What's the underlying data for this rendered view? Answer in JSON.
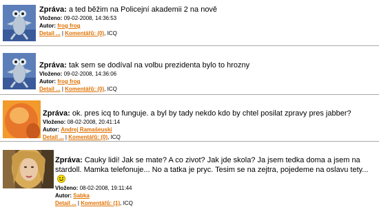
{
  "labels": {
    "message": "Zpráva:",
    "posted": "Vloženo:",
    "author": "Autor:",
    "detail": "Detail ...",
    "comments_prefix": "Komentářů:",
    "icq": "ICQ"
  },
  "posts": [
    {
      "avatar": "crazy-frog-avatar",
      "text": "a ted běžim na Policejní akademii 2 na nově",
      "date": "09-02-2008, 14:36:53",
      "author": "frog frog",
      "comments": "(0)"
    },
    {
      "avatar": "crazy-frog-avatar",
      "text": "tak sem se dodíval na volbu prezidenta bylo to hrozny",
      "date": "09-02-2008, 14:36:06",
      "author": "frog frog",
      "comments": "(0)"
    },
    {
      "avatar": "bald-head-avatar",
      "text": "ok. pres icq to funguje. a byl by tady nekdo kdo by chtel posilat zpravy pres jabber?",
      "date": "08-02-2008, 20:41:14",
      "author": "Andrej Ramašeuski",
      "comments": "(0)"
    },
    {
      "avatar": "blonde-woman-avatar",
      "text": "Cauky lidi! Jak se mate? A co zivot? Jak jde skola? Ja jsem tedka doma a jsem na stardoll. Mamka telefonuje... No a tatka je pryc. Tesim se na zejtra, pojedeme na oslavu tety...",
      "date": "08-02-2008, 19:11:44",
      "author": "Sabka",
      "comments": "(1)",
      "emoticon": "smiley-icon"
    }
  ]
}
